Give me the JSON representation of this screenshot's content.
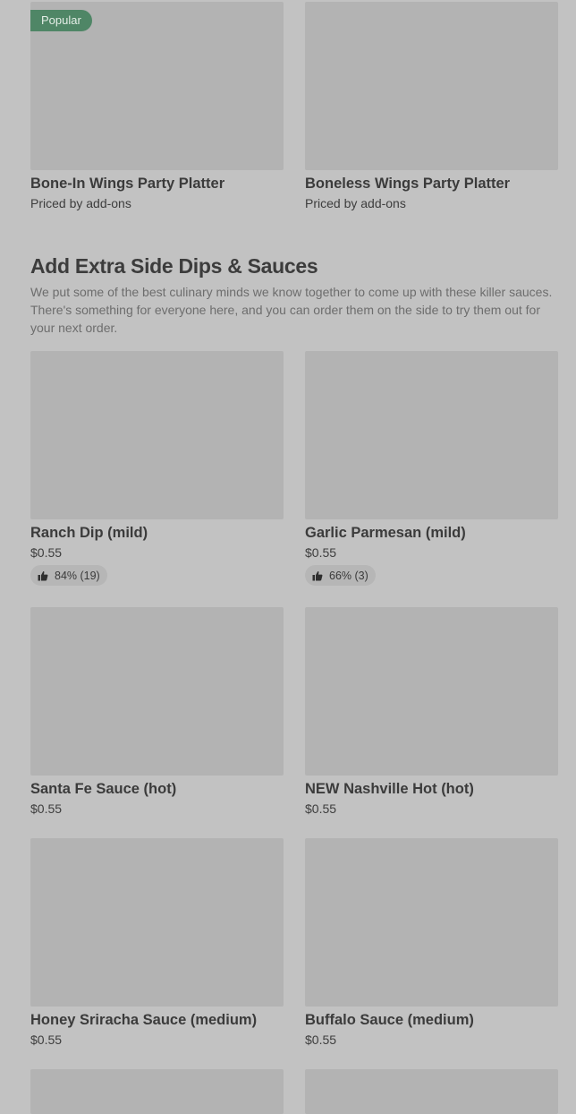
{
  "top_items": [
    {
      "badge": "Popular",
      "title": "Bone-In Wings Party Platter",
      "price": "Priced by add-ons"
    },
    {
      "title": "Boneless Wings Party Platter",
      "price": "Priced by add-ons"
    }
  ],
  "section": {
    "title": "Add Extra Side Dips & Sauces",
    "description": "We put some of the best culinary minds we know together to come up with these killer sauces. There's something for everyone here, and you can order them on the side to try them out for your next order."
  },
  "items": [
    {
      "title": "Ranch Dip (mild)",
      "price": "$0.55",
      "rating": "84% (19)"
    },
    {
      "title": "Garlic Parmesan (mild)",
      "price": "$0.55",
      "rating": "66% (3)"
    },
    {
      "title": "Santa Fe Sauce (hot)",
      "price": "$0.55"
    },
    {
      "title": "NEW Nashville Hot (hot)",
      "price": "$0.55"
    },
    {
      "title": "Honey Sriracha Sauce (medium)",
      "price": "$0.55"
    },
    {
      "title": "Buffalo Sauce (medium)",
      "price": "$0.55"
    }
  ],
  "icons": {
    "rating": "thumbs-up-icon"
  },
  "colors": {
    "badge_bg": "#4f8666",
    "background": "#c2c2c2",
    "image_placeholder": "#b3b3b3"
  }
}
